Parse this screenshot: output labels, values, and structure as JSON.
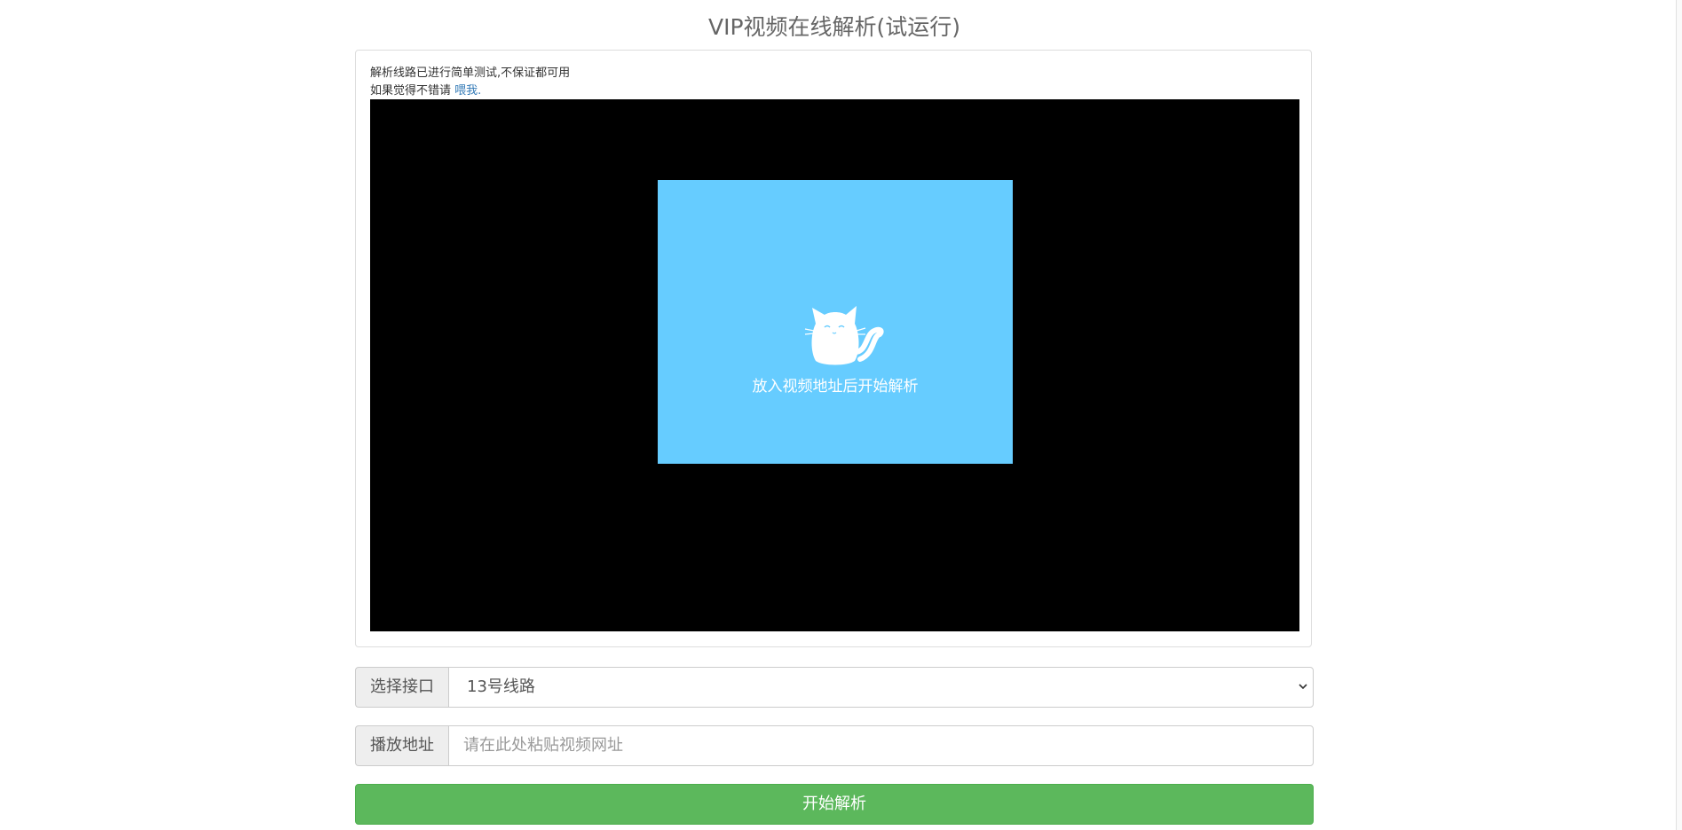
{
  "page": {
    "title": "VIP视频在线解析(试运行)"
  },
  "notice": {
    "line1": "解析线路已进行简单测试,不保证都可用",
    "line2_prefix": "如果觉得不错请 ",
    "link_label": "喂我."
  },
  "player": {
    "placeholder_text": "放入视频地址后开始解析",
    "placeholder_bg": "#66ccff",
    "icon": "cat-icon"
  },
  "interface": {
    "label": "选择接口",
    "selected": "13号线路"
  },
  "address": {
    "label": "播放地址",
    "placeholder": "请在此处粘贴视频网址",
    "value": ""
  },
  "actions": {
    "start_label": "开始解析",
    "start_color": "#5cb85c"
  }
}
